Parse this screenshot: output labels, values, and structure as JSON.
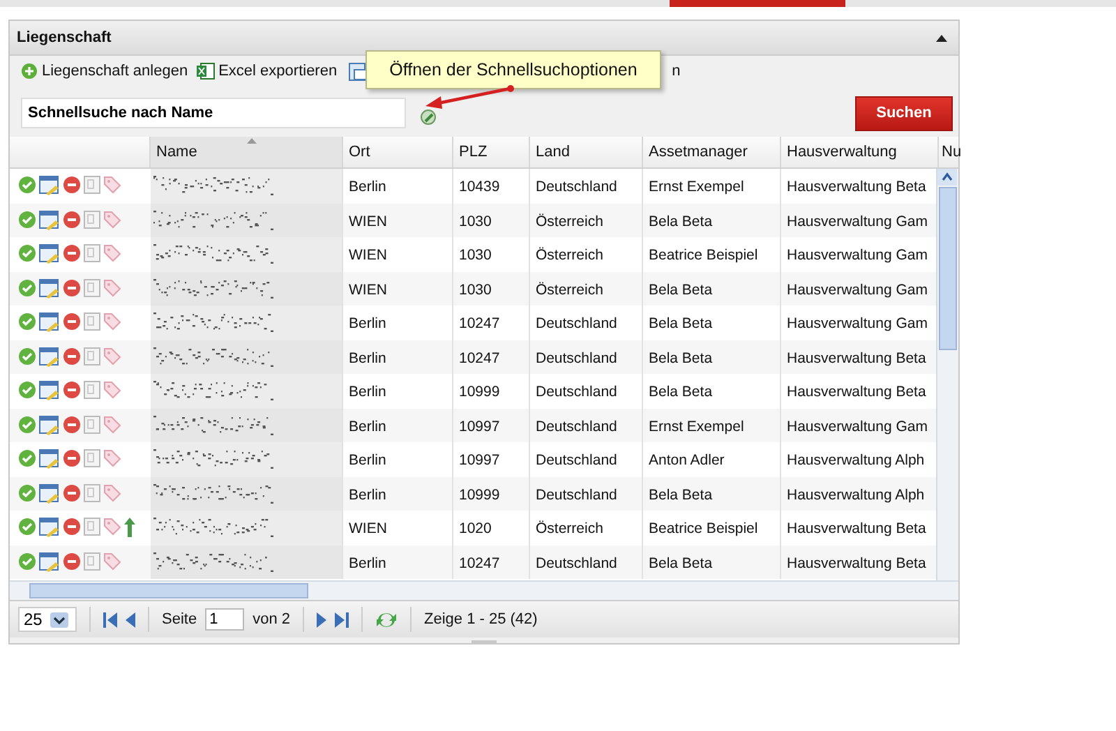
{
  "panel": {
    "title": "Liegenschaft"
  },
  "toolbar": [
    {
      "kind": "add",
      "label": "Liegenschaft anlegen"
    },
    {
      "kind": "excel",
      "label": "Excel exportieren"
    },
    {
      "kind": "print",
      "label": "n"
    }
  ],
  "search": {
    "value": "Schnellsuche nach Name",
    "button": "Suchen"
  },
  "tooltip": {
    "text": "Öffnen der Schnellsuchoptionen"
  },
  "table": {
    "columns": [
      "Name",
      "Ort",
      "PLZ",
      "Land",
      "Assetmanager",
      "Hausverwaltung",
      "Nu"
    ],
    "rows": [
      {
        "arrow": false,
        "ort": "Berlin",
        "plz": "10439",
        "land": "Deutschland",
        "manager": "Ernst Exempel",
        "verwaltung": "Hausverwaltung Beta"
      },
      {
        "arrow": false,
        "ort": "WIEN",
        "plz": "1030",
        "land": "Österreich",
        "manager": "Bela Beta",
        "verwaltung": "Hausverwaltung Gam"
      },
      {
        "arrow": false,
        "ort": "WIEN",
        "plz": "1030",
        "land": "Österreich",
        "manager": "Beatrice Beispiel",
        "verwaltung": "Hausverwaltung Gam"
      },
      {
        "arrow": false,
        "ort": "WIEN",
        "plz": "1030",
        "land": "Österreich",
        "manager": "Bela Beta",
        "verwaltung": "Hausverwaltung Gam"
      },
      {
        "arrow": false,
        "ort": "Berlin",
        "plz": "10247",
        "land": "Deutschland",
        "manager": "Bela Beta",
        "verwaltung": "Hausverwaltung Gam"
      },
      {
        "arrow": false,
        "ort": "Berlin",
        "plz": "10247",
        "land": "Deutschland",
        "manager": "Bela Beta",
        "verwaltung": "Hausverwaltung Beta"
      },
      {
        "arrow": false,
        "ort": "Berlin",
        "plz": "10999",
        "land": "Deutschland",
        "manager": "Bela Beta",
        "verwaltung": "Hausverwaltung Beta"
      },
      {
        "arrow": false,
        "ort": "Berlin",
        "plz": "10997",
        "land": "Deutschland",
        "manager": "Ernst Exempel",
        "verwaltung": "Hausverwaltung Gam"
      },
      {
        "arrow": false,
        "ort": "Berlin",
        "plz": "10997",
        "land": "Deutschland",
        "manager": "Anton Adler",
        "verwaltung": "Hausverwaltung Alph"
      },
      {
        "arrow": false,
        "ort": "Berlin",
        "plz": "10999",
        "land": "Deutschland",
        "manager": "Bela Beta",
        "verwaltung": "Hausverwaltung Alph"
      },
      {
        "arrow": true,
        "ort": "WIEN",
        "plz": "1020",
        "land": "Österreich",
        "manager": "Beatrice Beispiel",
        "verwaltung": "Hausverwaltung Beta"
      },
      {
        "arrow": false,
        "ort": "Berlin",
        "plz": "10247",
        "land": "Deutschland",
        "manager": "Bela Beta",
        "verwaltung": "Hausverwaltung Beta"
      }
    ]
  },
  "pager": {
    "page_size": "25",
    "page_label": "Seite",
    "page": "1",
    "of": "von 2",
    "summary": "Zeige 1 - 25 (42)"
  }
}
